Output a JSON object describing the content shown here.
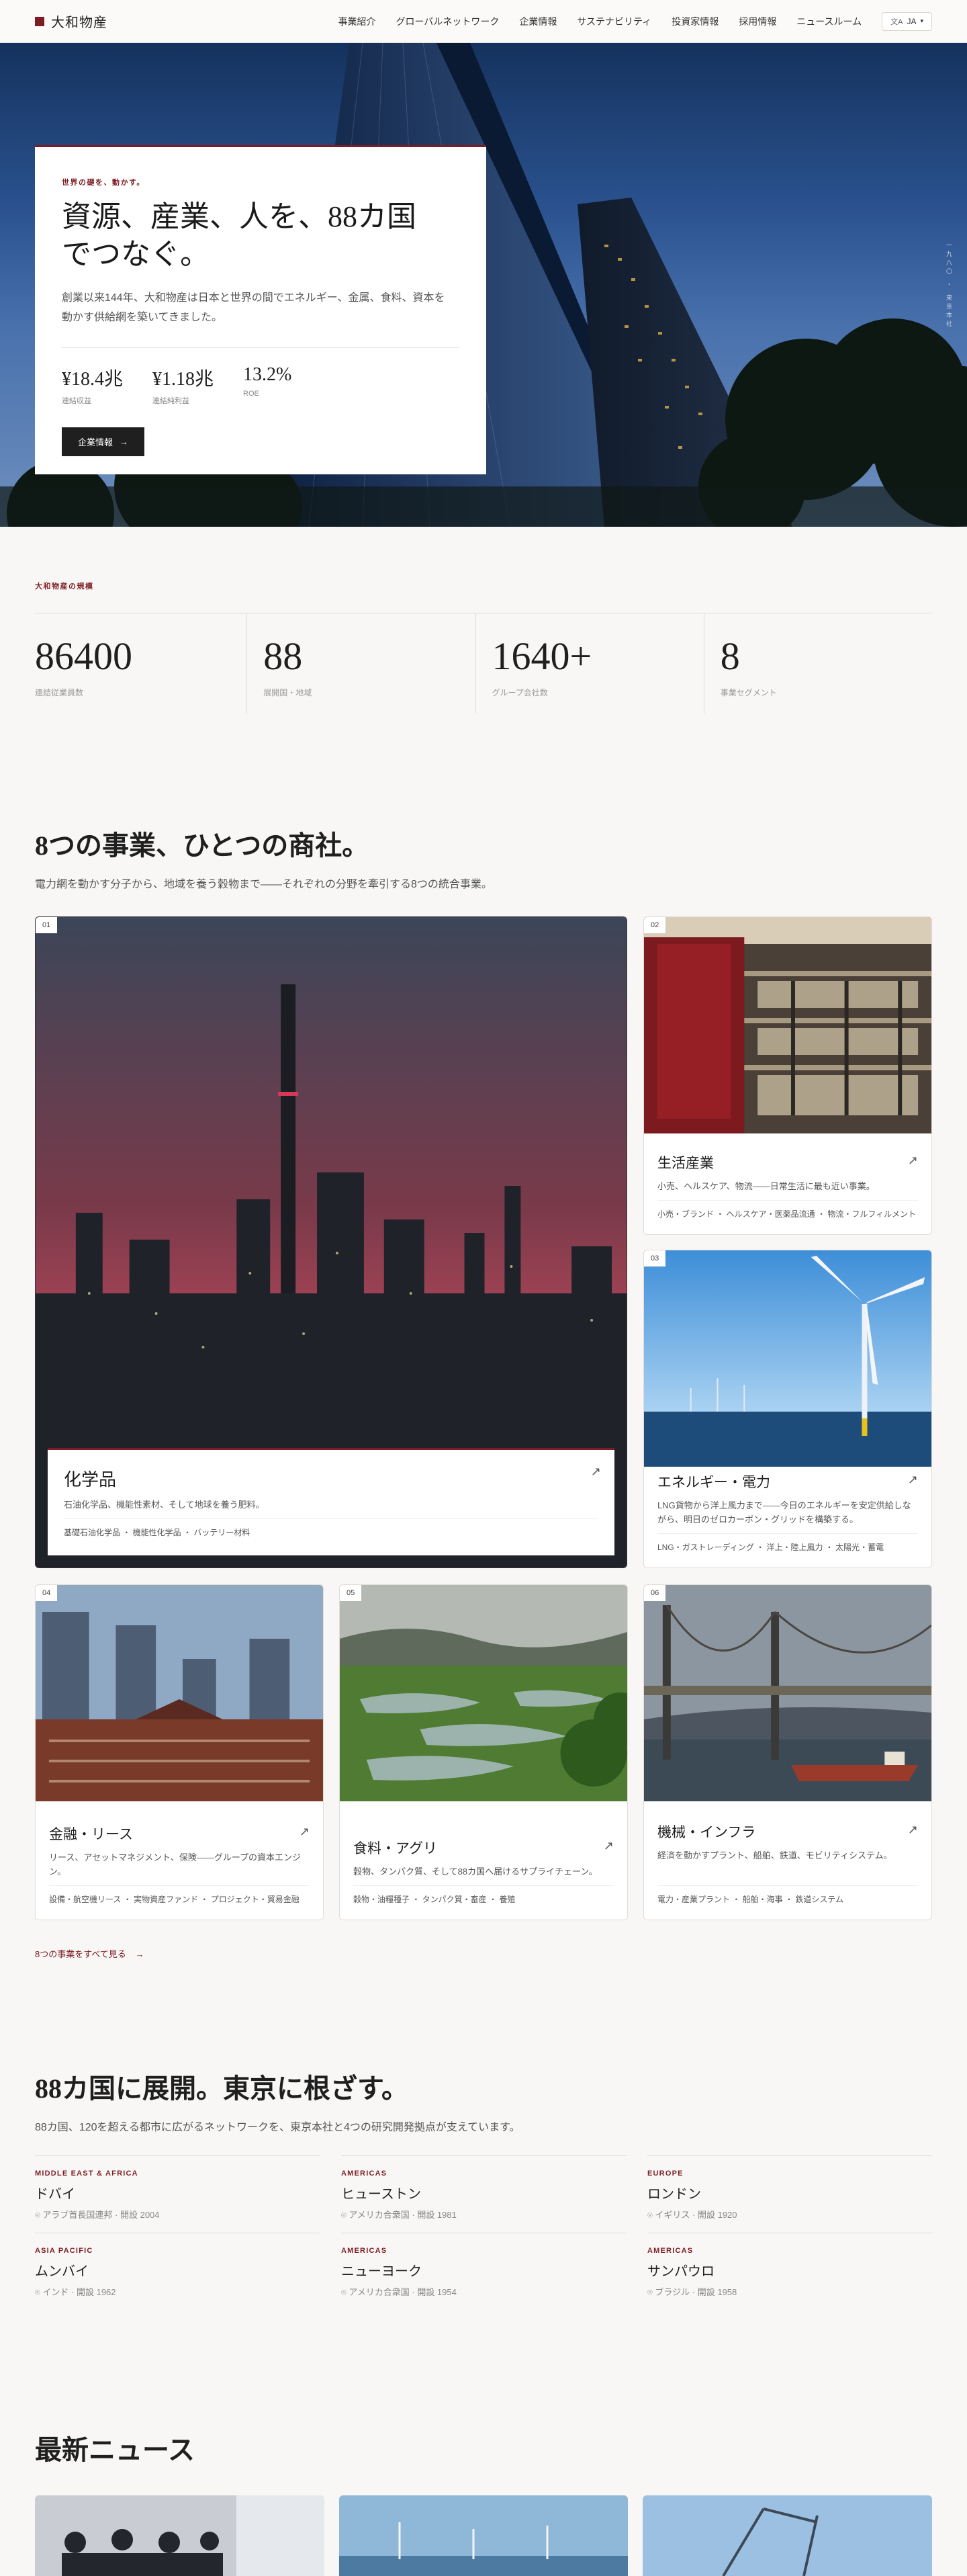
{
  "header": {
    "brand": "大和物産",
    "nav": [
      "事業紹介",
      "グローバルネットワーク",
      "企業情報",
      "サステナビリティ",
      "投資家情報",
      "採用情報",
      "ニュースルーム"
    ],
    "lang": "JA"
  },
  "hero": {
    "eyebrow": "世界の礎を、動かす。",
    "title_line1": "資源、産業、人を、88カ国",
    "title_line2": "でつなぐ。",
    "description": "創業以来144年、大和物産は日本と世界の間でエネルギー、金属、食料、資本を動かす供給網を築いてきました。",
    "stats": [
      {
        "value": "¥18.4兆",
        "label": "連結収益"
      },
      {
        "value": "¥1.18兆",
        "label": "連結純利益"
      },
      {
        "value": "13.2%",
        "label": "ROE"
      }
    ],
    "cta": "企業情報",
    "side_text": "一九八〇 ・ 東京本社"
  },
  "scale": {
    "eyebrow": "大和物産の規模",
    "items": [
      {
        "value": "86400",
        "label": "連結従業員数"
      },
      {
        "value": "88",
        "label": "展開国・地域"
      },
      {
        "value": "1640+",
        "label": "グループ会社数"
      },
      {
        "value": "8",
        "label": "事業セグメント"
      }
    ]
  },
  "business": {
    "title": "8つの事業、ひとつの商社。",
    "subtitle": "電力網を動かす分子から、地域を養う穀物まで——それぞれの分野を牽引する8つの統合事業。",
    "cards": [
      {
        "idx": "01",
        "title": "化学品",
        "desc": "石油化学品、機能性素材、そして地球を養う肥料。",
        "tags": "基礎石油化学品 ・ 機能性化学品 ・ バッテリー材料"
      },
      {
        "idx": "02",
        "title": "生活産業",
        "desc": "小売、ヘルスケア、物流——日常生活に最も近い事業。",
        "tags": "小売・ブランド ・ ヘルスケア・医薬品流通 ・ 物流・フルフィルメント"
      },
      {
        "idx": "03",
        "title": "エネルギー・電力",
        "desc": "LNG貨物から洋上風力まで——今日のエネルギーを安定供給しながら、明日のゼロカーボン・グリッドを構築する。",
        "tags": "LNG・ガストレーディング ・ 洋上・陸上風力 ・ 太陽光・蓄電"
      },
      {
        "idx": "04",
        "title": "金融・リース",
        "desc": "リース、アセットマネジメント、保険——グループの資本エンジン。",
        "tags": "設備・航空機リース ・ 実物資産ファンド ・ プロジェクト・貿易金融"
      },
      {
        "idx": "05",
        "title": "食料・アグリ",
        "desc": "穀物、タンパク質、そして88カ国へ届けるサプライチェーン。",
        "tags": "穀物・油糧種子 ・ タンパク質・畜産 ・ 養殖"
      },
      {
        "idx": "06",
        "title": "機械・インフラ",
        "desc": "経済を動かすプラント、船舶、鉄道、モビリティシステム。",
        "tags": "電力・産業プラント ・ 船舶・海事 ・ 鉄道システム"
      }
    ],
    "see_all": "8つの事業をすべて見る"
  },
  "global": {
    "title": "88カ国に展開。東京に根ざす。",
    "subtitle": "88カ国、120を超える都市に広がるネットワークを、東京本社と4つの研究開発拠点が支えています。",
    "offices": [
      {
        "region": "MIDDLE EAST & AFRICA",
        "city": "ドバイ",
        "meta": "アラブ首長国連邦 · 開設 2004"
      },
      {
        "region": "AMERICAS",
        "city": "ヒューストン",
        "meta": "アメリカ合衆国 · 開設 1981"
      },
      {
        "region": "EUROPE",
        "city": "ロンドン",
        "meta": "イギリス · 開設 1920"
      },
      {
        "region": "ASIA PACIFIC",
        "city": "ムンバイ",
        "meta": "インド · 開設 1962"
      },
      {
        "region": "AMERICAS",
        "city": "ニューヨーク",
        "meta": "アメリカ合衆国 · 開設 1954"
      },
      {
        "region": "AMERICAS",
        "city": "サンパウロ",
        "meta": "ブラジル · 開設 1958"
      }
    ]
  },
  "news": {
    "title": "最新ニュース"
  },
  "colors": {
    "accent": "#7d1c24",
    "ink": "#1f1f1f",
    "paper": "#f8f7f5"
  }
}
